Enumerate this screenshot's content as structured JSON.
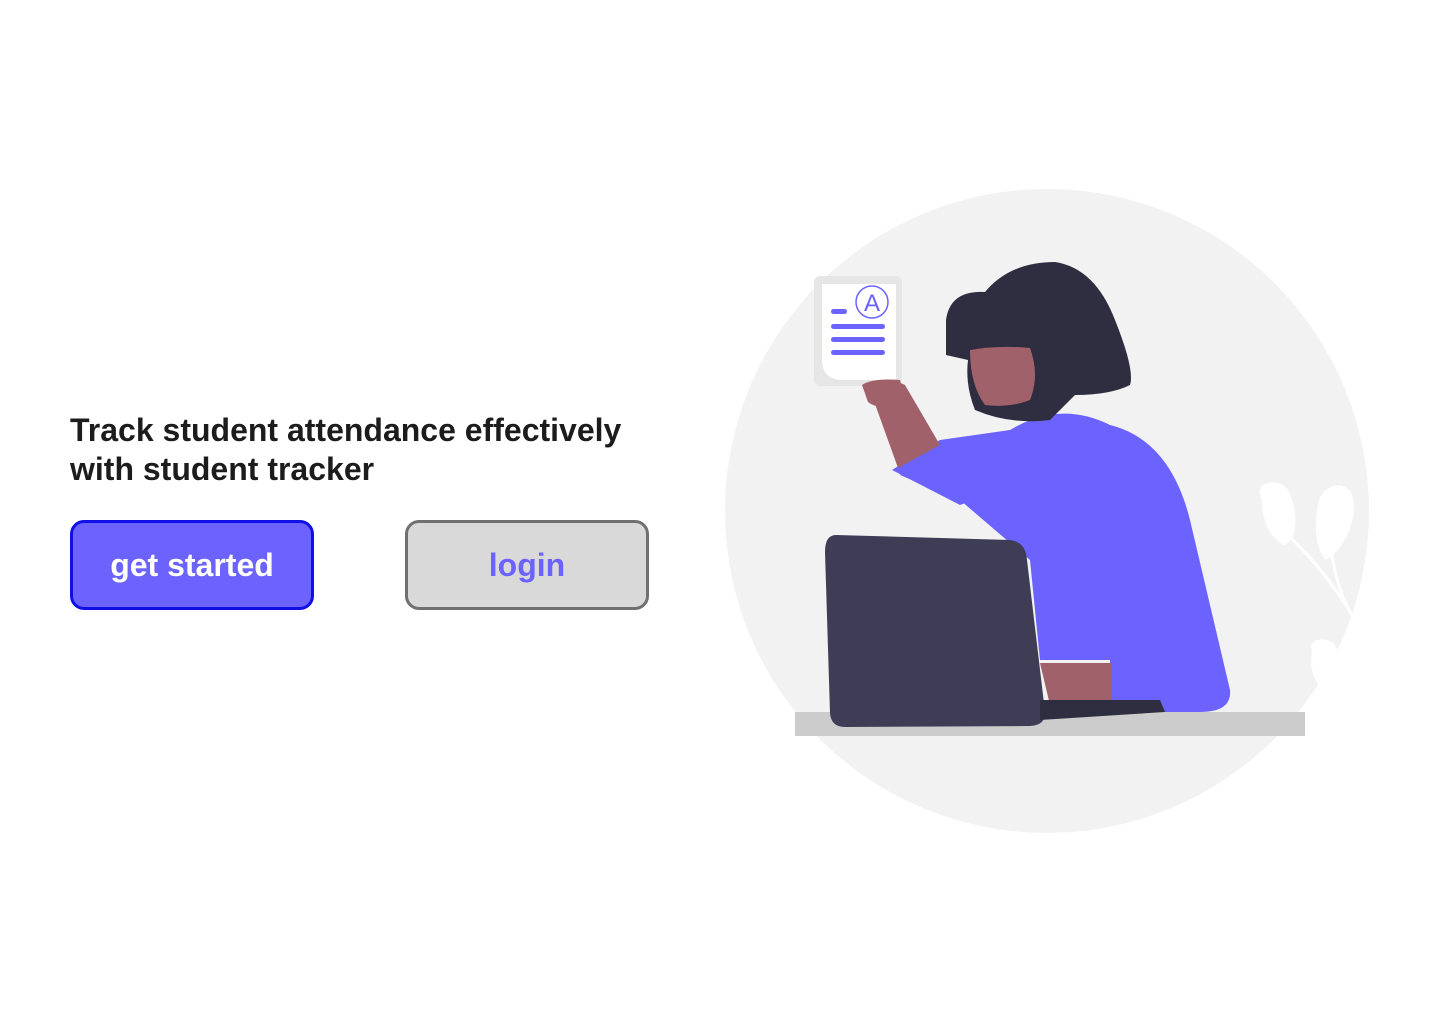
{
  "hero": {
    "headline": "Track student attendance effectively with student tracker"
  },
  "actions": {
    "get_started_label": "get started",
    "login_label": "login"
  },
  "illustration": {
    "description_icon": "woman-with-laptop-illustration",
    "document_grade": "A"
  },
  "colors": {
    "accent": "#6c63ff",
    "primary_border": "#1010e6",
    "secondary_bg": "#d9d9d9",
    "secondary_border": "#707070",
    "text": "#1c1c1c",
    "circle_bg": "#f2f2f2",
    "laptop": "#3f3d56",
    "hair": "#2f2e41",
    "skin": "#a0616a"
  }
}
